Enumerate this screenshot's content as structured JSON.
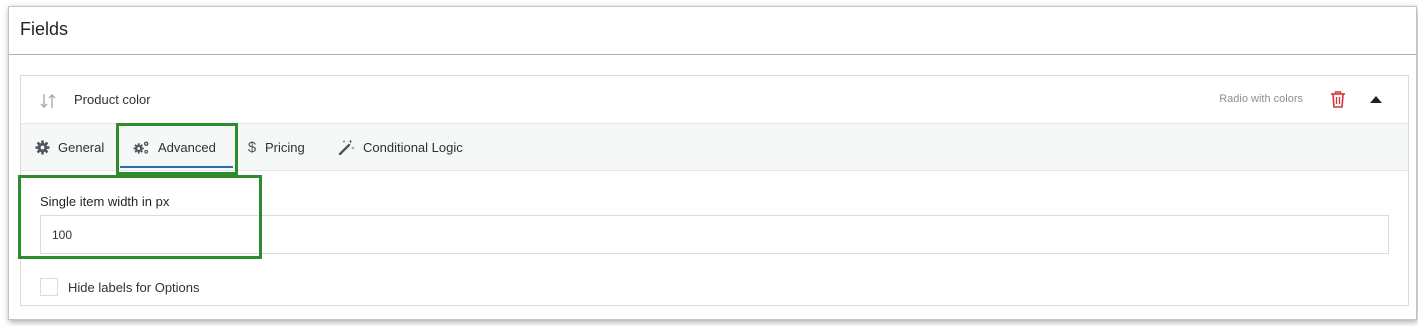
{
  "panel": {
    "title": "Fields"
  },
  "field": {
    "name": "Product color",
    "type_label": "Radio with colors"
  },
  "tabs": [
    {
      "label": "General",
      "icon": "gear-icon"
    },
    {
      "label": "Advanced",
      "icon": "gears-icon",
      "active": true
    },
    {
      "label": "Pricing",
      "icon": "dollar-icon"
    },
    {
      "label": "Conditional Logic",
      "icon": "magic-wand-icon"
    }
  ],
  "advanced": {
    "width_label": "Single item width in px",
    "width_value": "100",
    "hide_labels_label": "Hide labels for Options",
    "hide_labels_checked": false
  },
  "colors": {
    "accent": "#2271b1",
    "danger": "#d63638",
    "highlight": "#2e8b2e"
  }
}
